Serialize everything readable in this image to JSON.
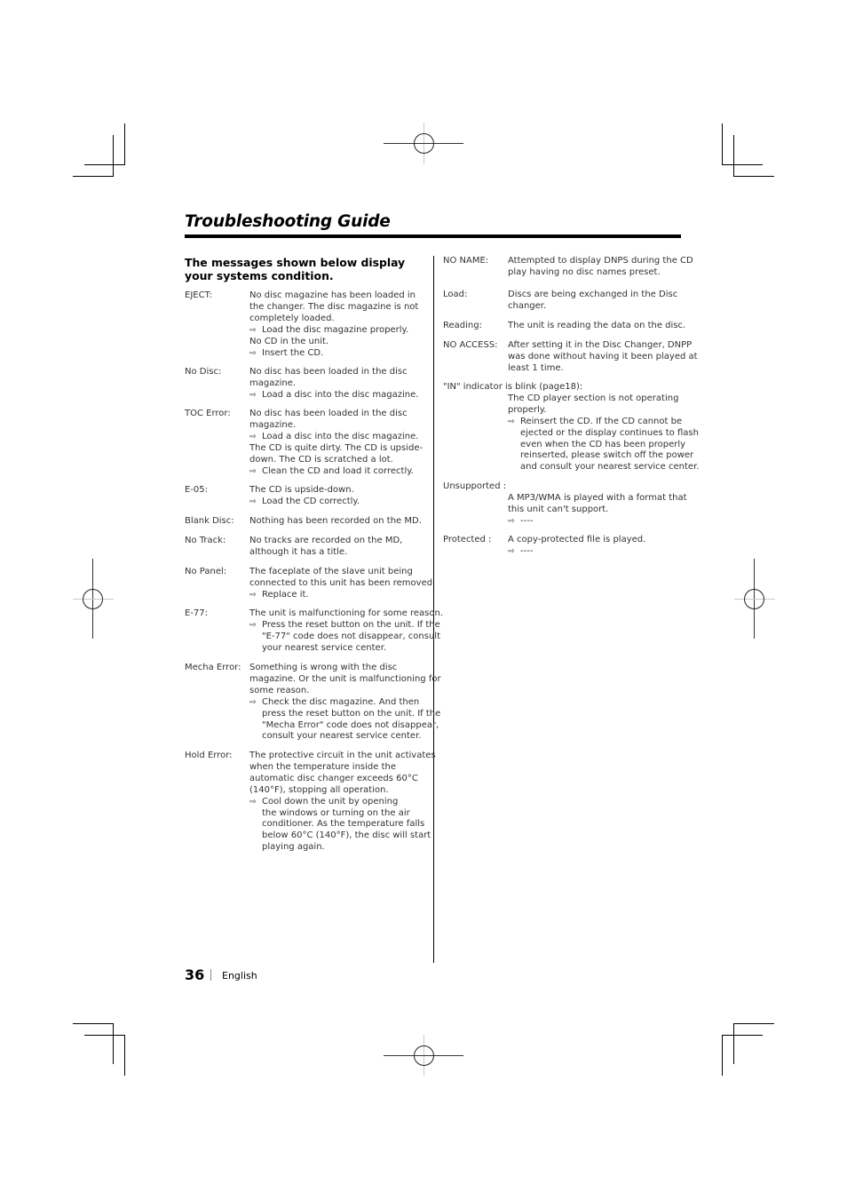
{
  "page": {
    "title": "Troubleshooting Guide",
    "page_number": "36",
    "language": "English",
    "subheading": "The messages shown below display your systems condition.",
    "action_icon": "arrow-right-outline-icon"
  },
  "left_column": [
    {
      "term": "EJECT:",
      "lines": [
        {
          "t": "No disc magazine has been loaded in"
        },
        {
          "t": "the changer. The disc magazine is not"
        },
        {
          "t": "completely loaded."
        },
        {
          "t": "Load the disc magazine properly.",
          "action": true
        },
        {
          "t": "No CD in the unit."
        },
        {
          "t": "Insert the CD.",
          "action": true
        }
      ]
    },
    {
      "term": "No Disc:",
      "lines": [
        {
          "t": "No disc has been loaded in the disc"
        },
        {
          "t": "magazine."
        },
        {
          "t": "Load a disc into the disc magazine.",
          "action": true
        }
      ]
    },
    {
      "term": "TOC Error:",
      "lines": [
        {
          "t": "No disc has been loaded in the disc"
        },
        {
          "t": "magazine."
        },
        {
          "t": "Load a disc into the disc magazine.",
          "action": true
        },
        {
          "t": "The CD is quite dirty. The CD is upside-"
        },
        {
          "t": "down. The CD is scratched a lot."
        },
        {
          "t": "Clean the CD and load it correctly.",
          "action": true
        }
      ]
    },
    {
      "term": "E-05:",
      "lines": [
        {
          "t": "The CD is upside-down."
        },
        {
          "t": "Load the CD correctly.",
          "action": true
        }
      ]
    },
    {
      "term": "Blank Disc:",
      "lines": [
        {
          "t": "Nothing has been recorded on the MD."
        }
      ]
    },
    {
      "term": "No Track:",
      "lines": [
        {
          "t": "No tracks are recorded on the MD,"
        },
        {
          "t": "although it has a title."
        }
      ]
    },
    {
      "term": "No Panel:",
      "lines": [
        {
          "t": "The faceplate of the slave unit being"
        },
        {
          "t": "connected to this unit has been removed."
        },
        {
          "t": "Replace it.",
          "action": true
        }
      ]
    },
    {
      "term": "E-77:",
      "lines": [
        {
          "t": "The unit is malfunctioning for some reason."
        },
        {
          "t": "Press the reset button on the unit. If the",
          "action": true
        },
        {
          "t": "\"E-77\" code does not disappear, consult",
          "cont": true
        },
        {
          "t": "your nearest service center.",
          "cont": true
        }
      ]
    },
    {
      "term": "Mecha Error:",
      "lines": [
        {
          "t": "Something is wrong with the disc"
        },
        {
          "t": "magazine. Or the unit is malfunctioning for"
        },
        {
          "t": "some reason."
        },
        {
          "t": "Check the disc magazine. And then",
          "action": true
        },
        {
          "t": "press the reset button on the unit. If the",
          "cont": true
        },
        {
          "t": "\"Mecha Error\" code does not disappear,",
          "cont": true
        },
        {
          "t": "consult your nearest service center.",
          "cont": true
        }
      ]
    },
    {
      "term": "Hold Error:",
      "lines": [
        {
          "t": "The protective circuit in the unit activates"
        },
        {
          "t": "when the temperature inside the"
        },
        {
          "t": "automatic disc changer exceeds 60°C"
        },
        {
          "t": "(140°F), stopping all operation."
        },
        {
          "t": "Cool down the unit by opening",
          "action": true
        },
        {
          "t": "the windows or turning on the air",
          "cont": true
        },
        {
          "t": "conditioner. As the temperature falls",
          "cont": true
        },
        {
          "t": "below 60°C (140°F), the disc will start",
          "cont": true
        },
        {
          "t": "playing again.",
          "cont": true
        }
      ]
    }
  ],
  "right_column": [
    {
      "term": "NO NAME:",
      "lines": [
        {
          "t": "Attempted to display DNPS during the CD"
        },
        {
          "t": "play having no disc names preset."
        }
      ]
    },
    {
      "term": "Load:",
      "lines": [
        {
          "t": "Discs are being exchanged in the Disc"
        },
        {
          "t": "changer."
        }
      ]
    },
    {
      "term": "Reading:",
      "lines": [
        {
          "t": "The unit is reading the data on the disc."
        }
      ]
    },
    {
      "term": "NO ACCESS:",
      "lines": [
        {
          "t": "After setting it in the Disc Changer, DNPP"
        },
        {
          "t": "was done without having it been played at"
        },
        {
          "t": "least 1 time."
        }
      ]
    },
    {
      "term": "\"IN\" indicator is blink (page18):",
      "wide": true,
      "lines": [
        {
          "t": "The CD player section is not operating"
        },
        {
          "t": "properly."
        },
        {
          "t": "Reinsert the CD. If the CD cannot be",
          "action": true
        },
        {
          "t": "ejected or the display continues to flash",
          "cont": true
        },
        {
          "t": "even when the CD has been properly",
          "cont": true
        },
        {
          "t": "reinserted, please switch off the power",
          "cont": true
        },
        {
          "t": "and consult your nearest service center.",
          "cont": true
        }
      ]
    },
    {
      "term": "Unsupported :",
      "wide": true,
      "lines": [
        {
          "t": "A MP3/WMA is played with a format that"
        },
        {
          "t": "this unit can't support."
        },
        {
          "t": "----",
          "action": true
        }
      ]
    },
    {
      "term": "Protected :",
      "lines": [
        {
          "t": " A copy-protected file is played."
        },
        {
          "t": "----",
          "action": true
        }
      ]
    }
  ]
}
